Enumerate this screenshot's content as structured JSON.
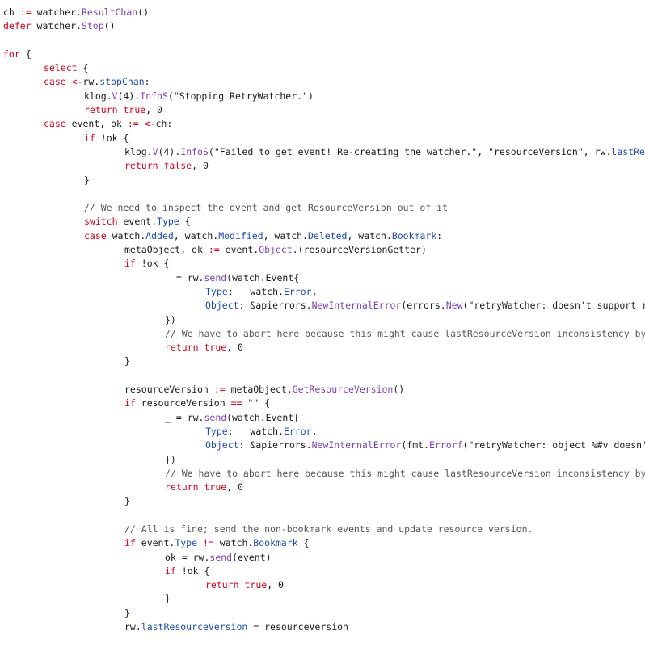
{
  "code": {
    "lines": [
      [
        [
          "plain",
          "ch "
        ],
        [
          "kw",
          ":="
        ],
        [
          "plain",
          " watcher."
        ],
        [
          "fn",
          "ResultChan"
        ],
        [
          "plain",
          "()"
        ]
      ],
      [
        [
          "kw",
          "defer"
        ],
        [
          "plain",
          " watcher."
        ],
        [
          "fn",
          "Stop"
        ],
        [
          "plain",
          "()"
        ]
      ],
      [],
      [
        [
          "kw",
          "for"
        ],
        [
          "plain",
          " {"
        ]
      ],
      [
        [
          "kw",
          "select"
        ],
        [
          "plain",
          " {"
        ]
      ],
      [
        [
          "kw",
          "case"
        ],
        [
          "plain",
          " "
        ],
        [
          "kw",
          "<-"
        ],
        [
          "plain",
          "rw."
        ],
        [
          "fld",
          "stopChan"
        ],
        [
          "plain",
          ":"
        ]
      ],
      [
        [
          "plain",
          "klog."
        ],
        [
          "fn",
          "V"
        ],
        [
          "plain",
          "(4)."
        ],
        [
          "fn",
          "InfoS"
        ],
        [
          "plain",
          "(\"Stopping RetryWatcher.\")"
        ]
      ],
      [
        [
          "kw",
          "return"
        ],
        [
          "plain",
          " "
        ],
        [
          "kw",
          "true"
        ],
        [
          "plain",
          ", 0"
        ]
      ],
      [
        [
          "kw",
          "case"
        ],
        [
          "plain",
          " event, ok "
        ],
        [
          "kw",
          ":="
        ],
        [
          "plain",
          " "
        ],
        [
          "kw",
          "<-"
        ],
        [
          "plain",
          "ch:"
        ]
      ],
      [
        [
          "kw",
          "if"
        ],
        [
          "plain",
          " !ok {"
        ]
      ],
      [
        [
          "plain",
          "klog."
        ],
        [
          "fn",
          "V"
        ],
        [
          "plain",
          "(4)."
        ],
        [
          "fn",
          "InfoS"
        ],
        [
          "plain",
          "(\"Failed to get event! Re-creating the watcher.\", \"resourceVersion\", rw."
        ],
        [
          "fld",
          "lastResourceVersi"
        ]
      ],
      [
        [
          "kw",
          "return"
        ],
        [
          "plain",
          " "
        ],
        [
          "kw",
          "false"
        ],
        [
          "plain",
          ", 0"
        ]
      ],
      [
        [
          "plain",
          "}"
        ]
      ],
      [],
      [
        [
          "cmt",
          "// We need to inspect the event and get ResourceVersion out of it"
        ]
      ],
      [
        [
          "kw",
          "switch"
        ],
        [
          "plain",
          " event."
        ],
        [
          "fld",
          "Type"
        ],
        [
          "plain",
          " {"
        ]
      ],
      [
        [
          "kw",
          "case"
        ],
        [
          "plain",
          " watch."
        ],
        [
          "fld",
          "Added"
        ],
        [
          "plain",
          ", watch."
        ],
        [
          "fld",
          "Modified"
        ],
        [
          "plain",
          ", watch."
        ],
        [
          "fld",
          "Deleted"
        ],
        [
          "plain",
          ", watch."
        ],
        [
          "fld",
          "Bookmark"
        ],
        [
          "plain",
          ":"
        ]
      ],
      [
        [
          "plain",
          "metaObject, ok "
        ],
        [
          "kw",
          ":="
        ],
        [
          "plain",
          " event."
        ],
        [
          "fn",
          "Object"
        ],
        [
          "plain",
          ".(resourceVersionGetter)"
        ]
      ],
      [
        [
          "kw",
          "if"
        ],
        [
          "plain",
          " !ok {"
        ]
      ],
      [
        [
          "plain",
          "_ = rw."
        ],
        [
          "fn",
          "send"
        ],
        [
          "plain",
          "(watch.Event{"
        ]
      ],
      [
        [
          "fld",
          "Type"
        ],
        [
          "plain",
          ":   watch."
        ],
        [
          "fld",
          "Error"
        ],
        [
          "plain",
          ","
        ]
      ],
      [
        [
          "fld",
          "Object"
        ],
        [
          "plain",
          ": &apierrors."
        ],
        [
          "fn",
          "NewInternalError"
        ],
        [
          "plain",
          "(errors."
        ],
        [
          "fn",
          "New"
        ],
        [
          "plain",
          "(\"retryWatcher: doesn't support resourceVe"
        ]
      ],
      [
        [
          "plain",
          "})"
        ]
      ],
      [
        [
          "cmt",
          "// We have to abort here because this might cause lastResourceVersion inconsistency by skipping"
        ]
      ],
      [
        [
          "kw",
          "return"
        ],
        [
          "plain",
          " "
        ],
        [
          "kw",
          "true"
        ],
        [
          "plain",
          ", 0"
        ]
      ],
      [
        [
          "plain",
          "}"
        ]
      ],
      [],
      [
        [
          "plain",
          "resourceVersion "
        ],
        [
          "kw",
          ":="
        ],
        [
          "plain",
          " metaObject."
        ],
        [
          "fn",
          "GetResourceVersion"
        ],
        [
          "plain",
          "()"
        ]
      ],
      [
        [
          "kw",
          "if"
        ],
        [
          "plain",
          " resourceVersion "
        ],
        [
          "kw",
          "=="
        ],
        [
          "plain",
          " \"\" {"
        ]
      ],
      [
        [
          "plain",
          "_ = rw."
        ],
        [
          "fn",
          "send"
        ],
        [
          "plain",
          "(watch.Event{"
        ]
      ],
      [
        [
          "fld",
          "Type"
        ],
        [
          "plain",
          ":   watch."
        ],
        [
          "fld",
          "Error"
        ],
        [
          "plain",
          ","
        ]
      ],
      [
        [
          "fld",
          "Object"
        ],
        [
          "plain",
          ": &apierrors."
        ],
        [
          "fn",
          "NewInternalError"
        ],
        [
          "plain",
          "(fmt."
        ],
        [
          "fn",
          "Errorf"
        ],
        [
          "plain",
          "(\"retryWatcher: object %#v doesn't suppor"
        ]
      ],
      [
        [
          "plain",
          "})"
        ]
      ],
      [
        [
          "cmt",
          "// We have to abort here because this might cause lastResourceVersion inconsistency by skipping"
        ]
      ],
      [
        [
          "kw",
          "return"
        ],
        [
          "plain",
          " "
        ],
        [
          "kw",
          "true"
        ],
        [
          "plain",
          ", 0"
        ]
      ],
      [
        [
          "plain",
          "}"
        ]
      ],
      [],
      [
        [
          "cmt",
          "// All is fine; send the non-bookmark events and update resource version."
        ]
      ],
      [
        [
          "kw",
          "if"
        ],
        [
          "plain",
          " event."
        ],
        [
          "fld",
          "Type"
        ],
        [
          "plain",
          " "
        ],
        [
          "kw",
          "!="
        ],
        [
          "plain",
          " watch."
        ],
        [
          "fld",
          "Bookmark"
        ],
        [
          "plain",
          " {"
        ]
      ],
      [
        [
          "plain",
          "ok = rw."
        ],
        [
          "fn",
          "send"
        ],
        [
          "plain",
          "(event)"
        ]
      ],
      [
        [
          "kw",
          "if"
        ],
        [
          "plain",
          " !ok {"
        ]
      ],
      [
        [
          "kw",
          "return"
        ],
        [
          "plain",
          " "
        ],
        [
          "kw",
          "true"
        ],
        [
          "plain",
          ", 0"
        ]
      ],
      [
        [
          "plain",
          "}"
        ]
      ],
      [
        [
          "plain",
          "}"
        ]
      ],
      [
        [
          "plain",
          "rw."
        ],
        [
          "fld",
          "lastResourceVersion"
        ],
        [
          "plain",
          " = resourceVersion"
        ]
      ]
    ]
  }
}
